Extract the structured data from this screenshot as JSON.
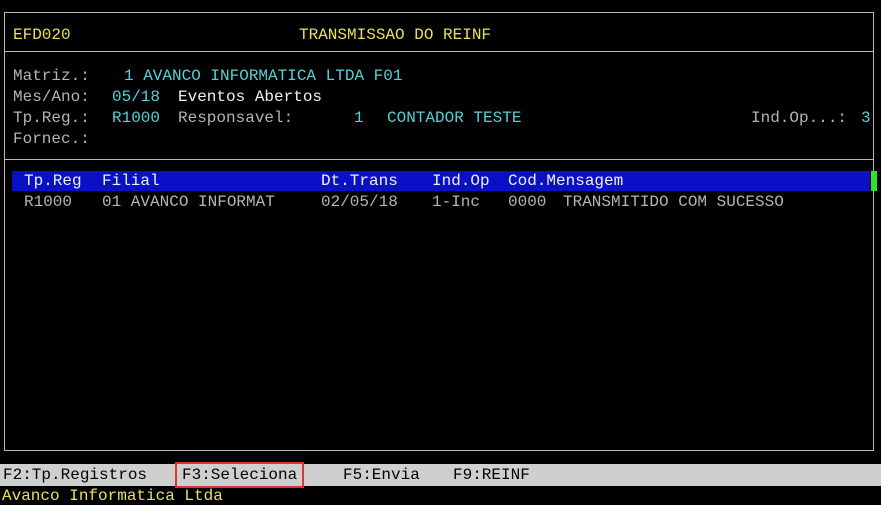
{
  "header": {
    "program_code": "EFD020",
    "title": "TRANSMISSAO DO REINF"
  },
  "info": {
    "matriz_label": "Matriz.:",
    "matriz_value": "1 AVANCO INFORMATICA LTDA F01",
    "mesano_label": "Mes/Ano:",
    "mesano_value": "05/18",
    "eventos": "Eventos Abertos",
    "tpreg_label": "Tp.Reg.:",
    "tpreg_value": "R1000",
    "responsavel_label": "Responsavel:",
    "responsavel_code": "1",
    "responsavel_name": "CONTADOR TESTE",
    "indop_label": "Ind.Op...:",
    "indop_value": "3",
    "fornec_label": "Fornec.:"
  },
  "table": {
    "columns": [
      "Tp.Reg",
      "Filial",
      "Dt.Trans",
      "Ind.Op",
      "Cod.Mensagem"
    ],
    "rows": [
      {
        "tpreg": "R1000",
        "filial": "01 AVANCO INFORMAT",
        "dttrans": "02/05/18",
        "indop": "1-Inc",
        "cod": "0000",
        "mensagem": "TRANSMITIDO COM SUCESSO"
      }
    ]
  },
  "function_keys": {
    "f2": "F2:Tp.Registros",
    "f3": "F3:Seleciona",
    "f5": "F5:Envia",
    "f9": "F9:REINF"
  },
  "status": {
    "company": "Avanco Informatica Ltda"
  },
  "colors": {
    "highlight": "#0a10c6",
    "selected_key_border": "#e0322f",
    "label_cyan": "#56d2d6",
    "title_yellow": "#e8e05c"
  }
}
